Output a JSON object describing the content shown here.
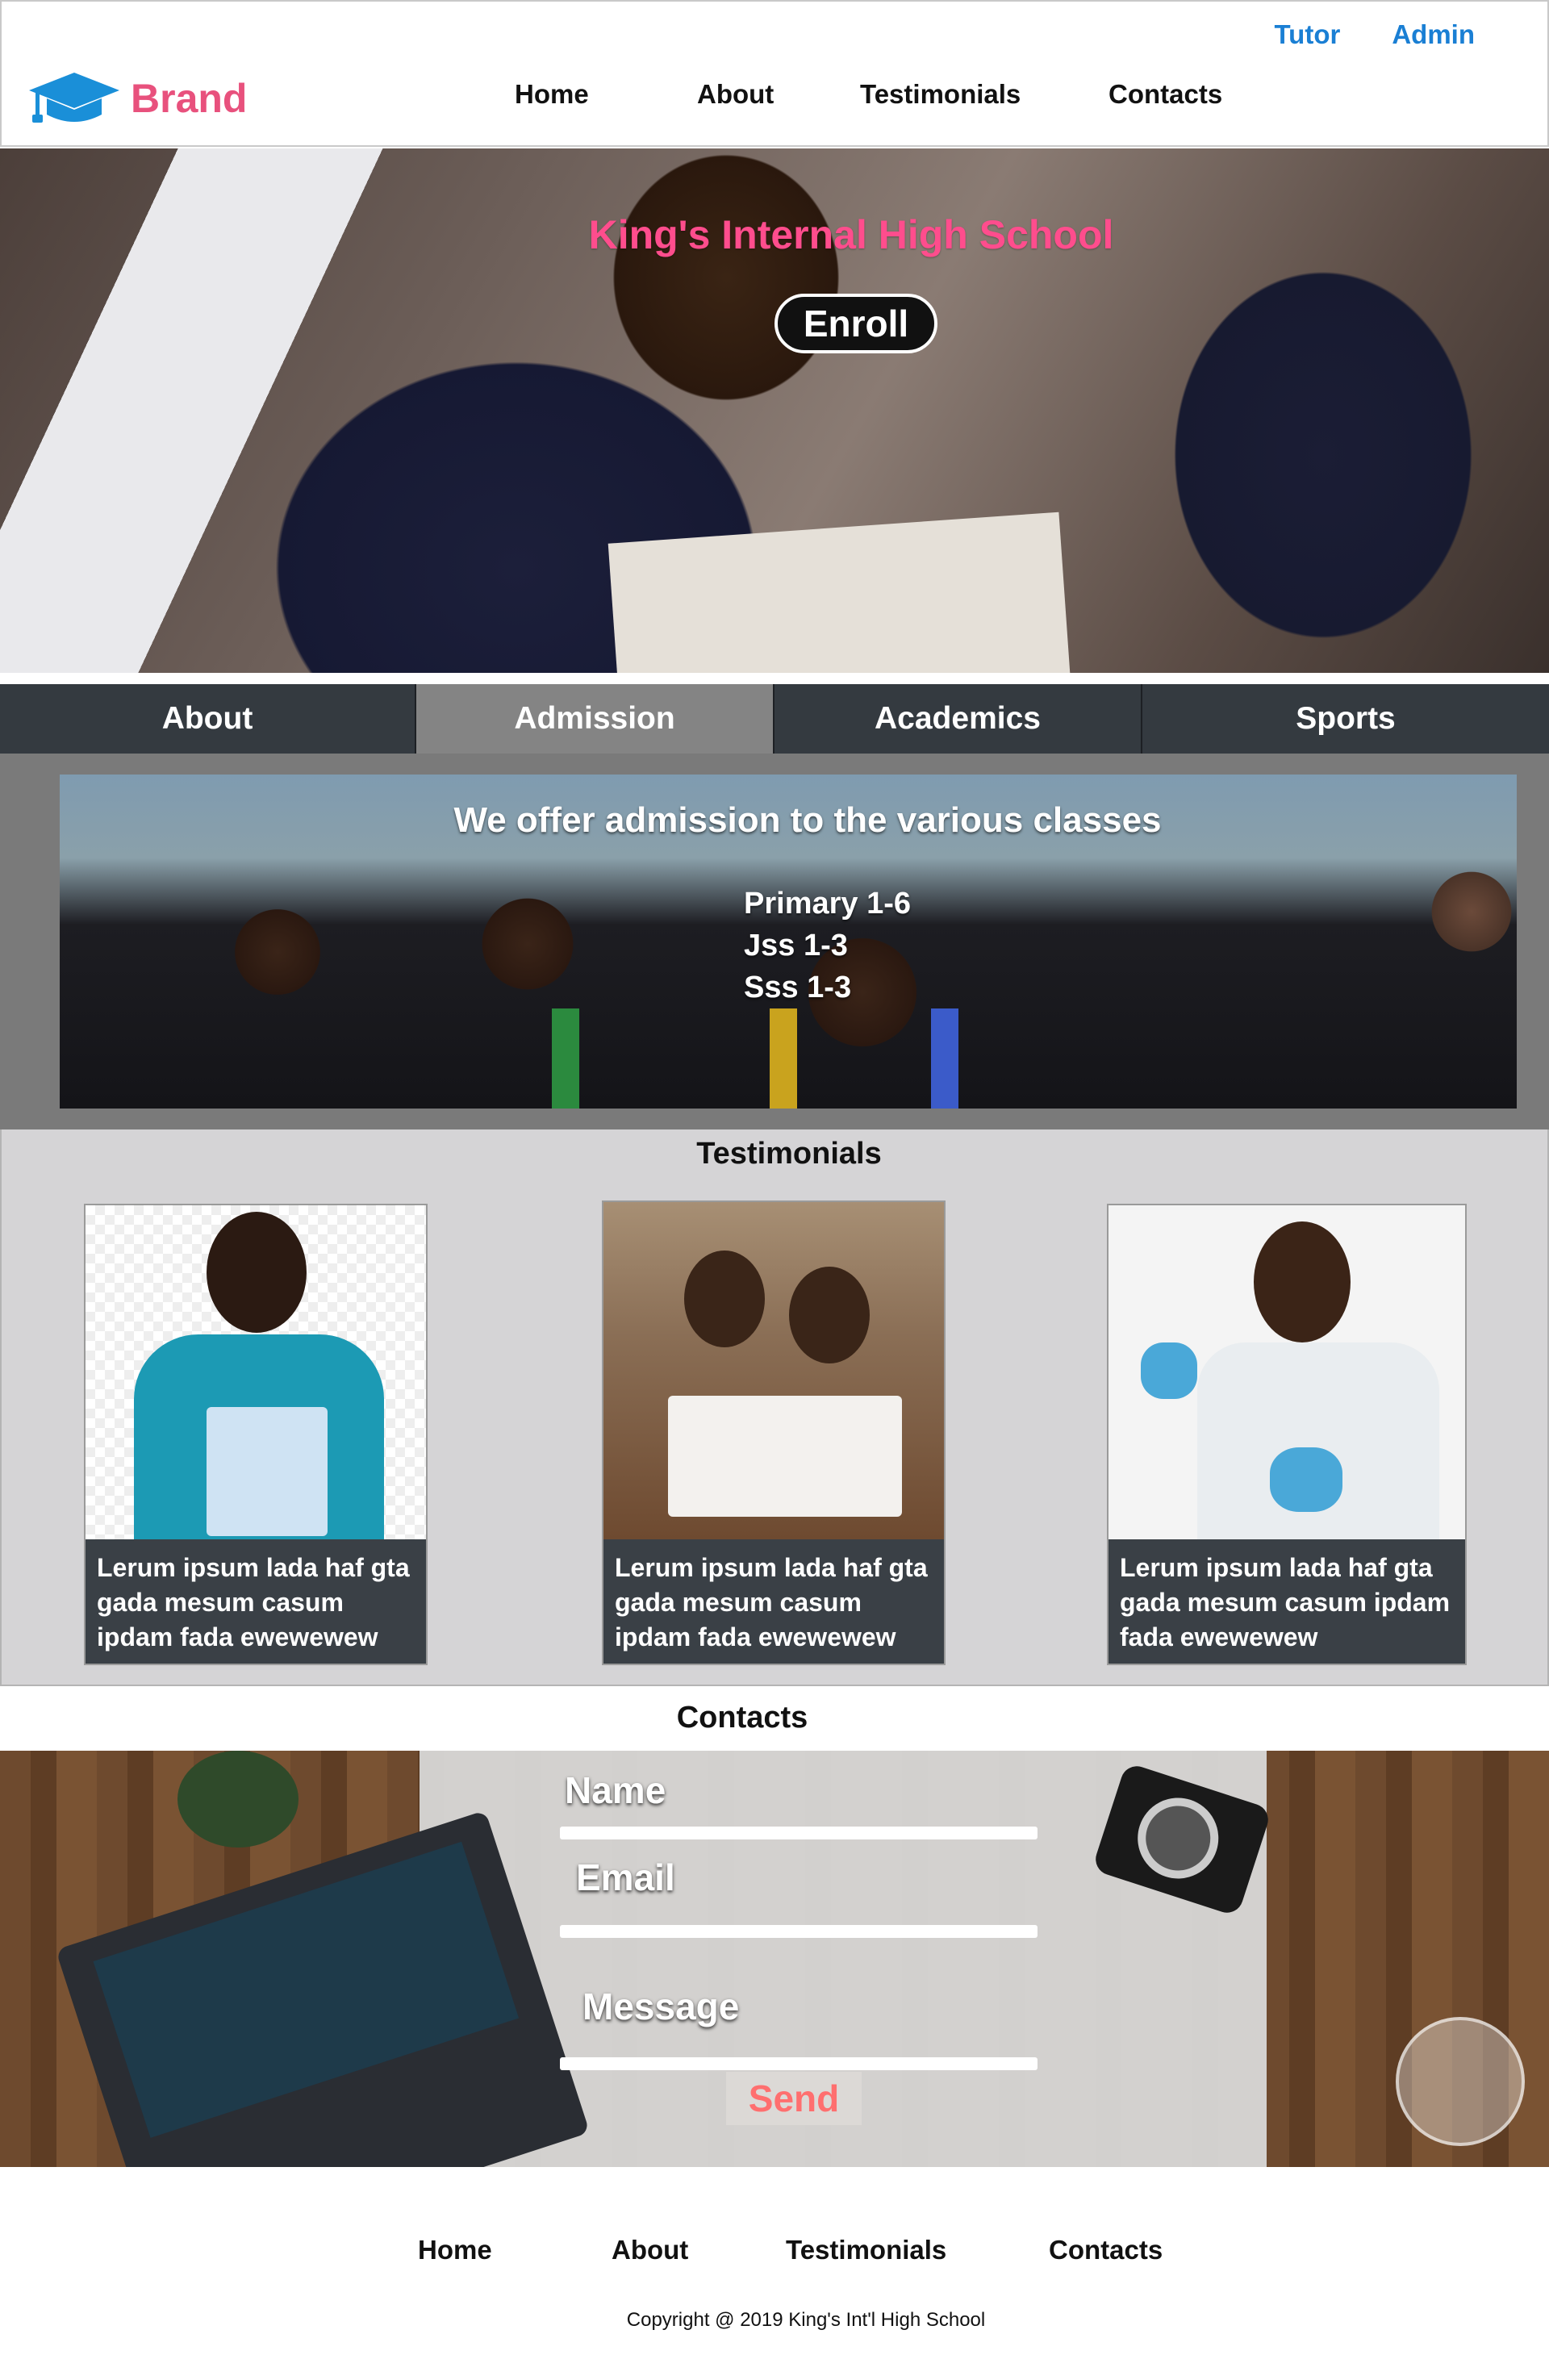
{
  "brand": {
    "name": "Brand",
    "color": "#e8517d",
    "icon": "graduation-cap-icon"
  },
  "top_links": [
    "Tutor",
    "Admin"
  ],
  "nav": [
    "Home",
    "About",
    "Testimonials",
    "Contacts"
  ],
  "hero": {
    "title": "King's Internal High School",
    "enroll_label": "Enroll"
  },
  "tabs": [
    {
      "label": "About",
      "active": false
    },
    {
      "label": "Admission",
      "active": true
    },
    {
      "label": "Academics",
      "active": false
    },
    {
      "label": "Sports",
      "active": false
    }
  ],
  "admission": {
    "title": "We offer admission to the various classes",
    "classes": [
      "Primary 1-6",
      "Jss 1-3",
      "Sss 1-3"
    ]
  },
  "testimonials": {
    "title": "Testimonials",
    "cards": [
      {
        "caption": "Lerum ipsum lada haf gta gada mesum casum ipdam fada ewewewew"
      },
      {
        "caption": "Lerum ipsum lada haf gta gada mesum casum ipdam fada ewewewew"
      },
      {
        "caption": "Lerum ipsum lada haf gta gada mesum casum ipdam fada ewewewew"
      }
    ]
  },
  "contacts": {
    "title": "Contacts",
    "name_label": "Name",
    "email_label": "Email",
    "message_label": "Message",
    "send_label": "Send"
  },
  "footer": {
    "nav": [
      "Home",
      "About",
      "Testimonials",
      "Contacts"
    ],
    "copyright": "Copyright @ 2019 King's Int'l High School"
  },
  "colors": {
    "accent_blue": "#1a7fd4",
    "hero_title_pink": "#ff4d8d",
    "tab_bar": "#343a40",
    "tab_active": "#848484",
    "card_caption_bg": "#3a4046",
    "send_text": "#ff6f6f"
  }
}
